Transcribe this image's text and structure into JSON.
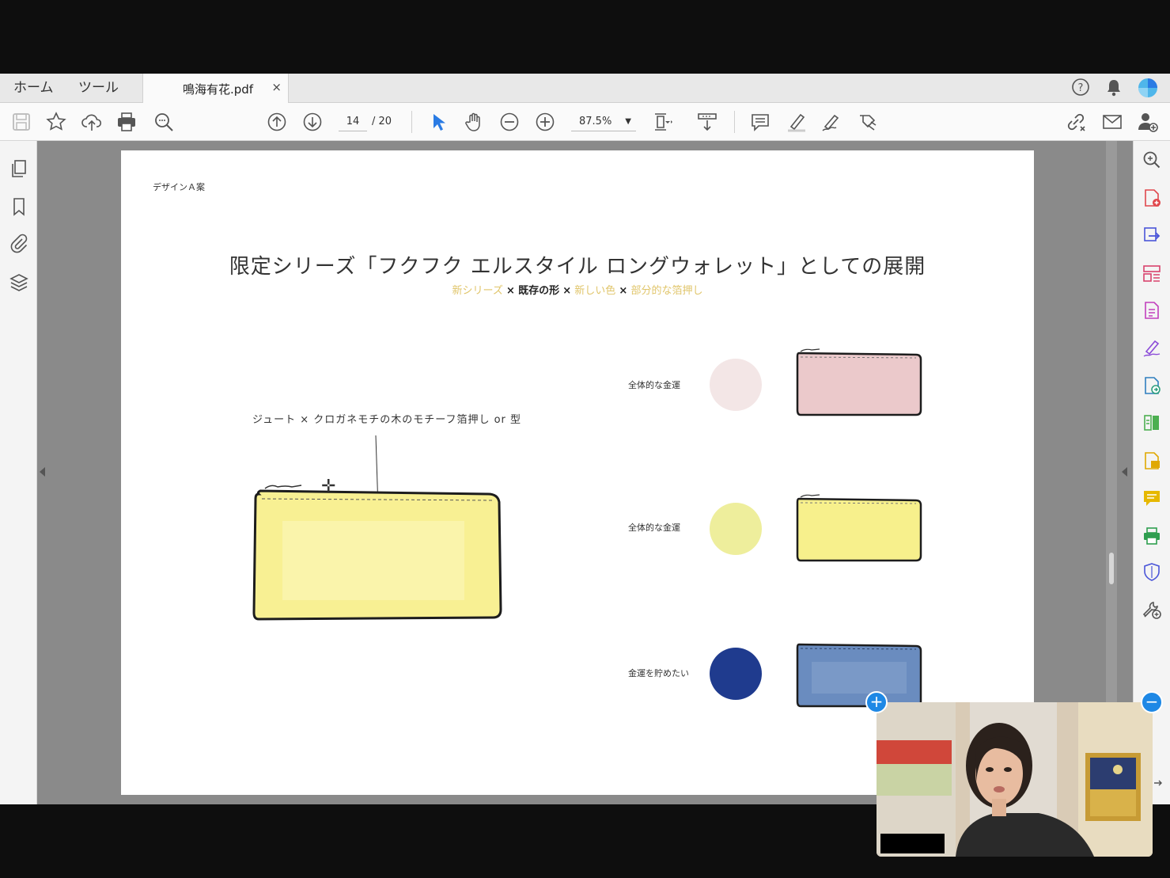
{
  "tabs": {
    "home": "ホーム",
    "tools": "ツール",
    "document": "鳴海有花.pdf",
    "close": "×"
  },
  "toolbar": {
    "page_current": "14",
    "page_total": "/ 20",
    "zoom": "87.5%"
  },
  "page": {
    "header_label": "デザインＡ案",
    "title": "限定シリーズ「フクフク エルスタイル ロングウォレット」としての展開",
    "subtitle": {
      "part1": "新シリーズ",
      "x1": "×",
      "part2": "既存の形",
      "x2": "×",
      "part3": "新しい色",
      "x3": "×",
      "part4": "部分的な箔押し"
    },
    "motif_label": "ジュート × クロガネモチの木のモチーフ箔押し or 型",
    "rows": [
      {
        "label": "全体的な金運",
        "color": "#f3e6e6",
        "wallet_color": "#ebc9cb"
      },
      {
        "label": "全体的な金運",
        "color": "#eeee9c",
        "wallet_color": "#f7f08c"
      },
      {
        "label": "金運を貯めたい",
        "color": "#1f3b8e",
        "wallet_color": "#6a8cbf"
      }
    ],
    "main_wallet_color": "#f8f093"
  },
  "icons": {
    "toolbar": [
      "save-icon",
      "star-icon",
      "upload-icon",
      "print-icon",
      "zoom-search-icon",
      "page-up-icon",
      "page-down-icon",
      "select-cursor-icon",
      "hand-icon",
      "zoom-out-icon",
      "zoom-in-icon",
      "fit-page-icon",
      "scroll-mode-icon",
      "comment-icon",
      "highlight-icon",
      "sign-icon",
      "share-icon",
      "link-icon",
      "email-icon",
      "add-user-icon"
    ],
    "left_panel": [
      "pages-icon",
      "bookmark-icon",
      "attachment-icon",
      "layers-icon"
    ],
    "right_panel": [
      "search-zoom-icon",
      "create-pdf-icon",
      "export-pdf-icon",
      "organize-icon",
      "edit-pdf-icon",
      "fill-sign-icon",
      "send-review-icon",
      "compare-icon",
      "share-file-icon",
      "comment-tool-icon",
      "print-production-icon",
      "protect-icon",
      "more-tools-icon"
    ]
  },
  "colors": {
    "accent_blue": "#2a7be4",
    "gold_text": "#e0c56a"
  }
}
